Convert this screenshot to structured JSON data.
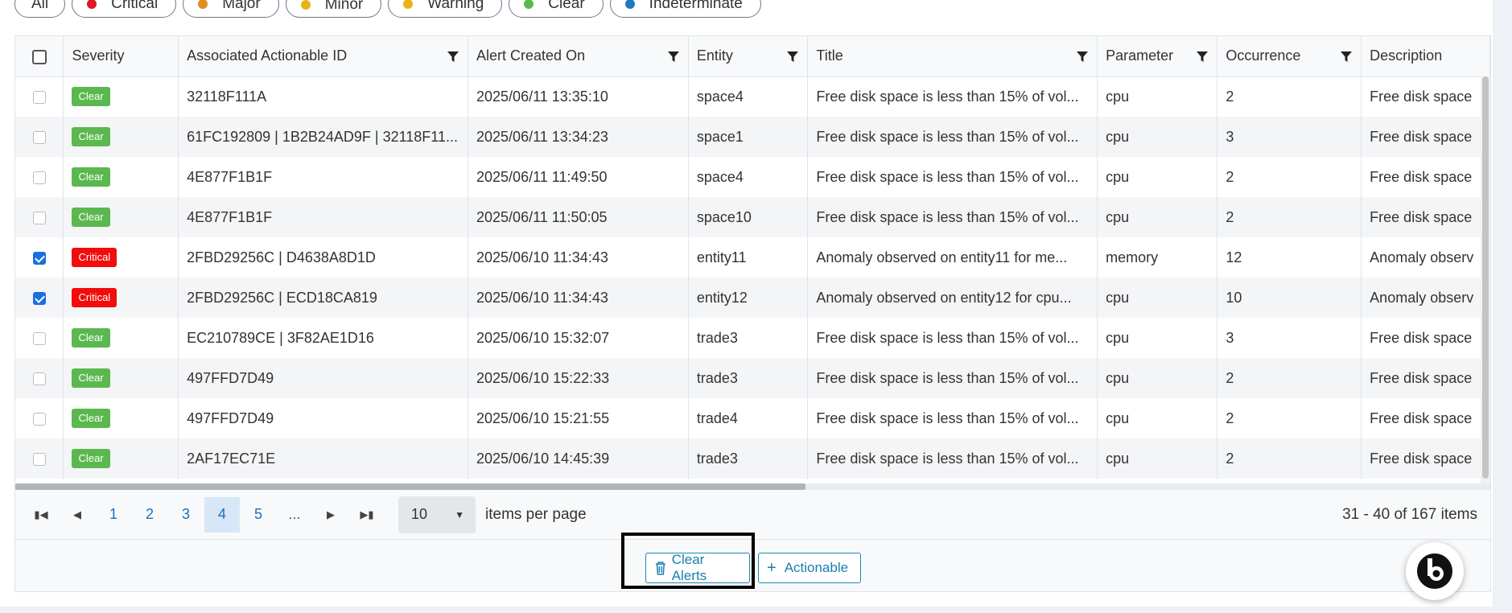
{
  "filters": [
    {
      "label": "All",
      "dot": null,
      "active": false
    },
    {
      "label": "Critical",
      "dot": "#e0181f",
      "active": false
    },
    {
      "label": "Major",
      "dot": "#e08e1c",
      "active": false
    },
    {
      "label": "Minor",
      "dot": "#e8b31a",
      "active": true
    },
    {
      "label": "Warning",
      "dot": "#e8b31a",
      "active": false
    },
    {
      "label": "Clear",
      "dot": "#5bb84f",
      "active": false
    },
    {
      "label": "Indeterminate",
      "dot": "#1a7bc2",
      "active": false
    }
  ],
  "columns": {
    "severity": "Severity",
    "actionable_id": "Associated Actionable ID",
    "created_on": "Alert Created On",
    "entity": "Entity",
    "title": "Title",
    "parameter": "Parameter",
    "occurrence": "Occurrence",
    "description": "Description"
  },
  "rows": [
    {
      "checked": false,
      "severity": "Clear",
      "actionable_id": "32118F111A",
      "created_on": "2025/06/11 13:35:10",
      "entity": "space4",
      "title": "Free disk space is less than 15% of vol...",
      "parameter": "cpu",
      "occurrence": "2",
      "description": "Free disk space"
    },
    {
      "checked": false,
      "severity": "Clear",
      "actionable_id": "61FC192809 | 1B2B24AD9F | 32118F11...",
      "created_on": "2025/06/11 13:34:23",
      "entity": "space1",
      "title": "Free disk space is less than 15% of vol...",
      "parameter": "cpu",
      "occurrence": "3",
      "description": "Free disk space"
    },
    {
      "checked": false,
      "severity": "Clear",
      "actionable_id": "4E877F1B1F",
      "created_on": "2025/06/11 11:49:50",
      "entity": "space4",
      "title": "Free disk space is less than 15% of vol...",
      "parameter": "cpu",
      "occurrence": "2",
      "description": "Free disk space"
    },
    {
      "checked": false,
      "severity": "Clear",
      "actionable_id": "4E877F1B1F",
      "created_on": "2025/06/11 11:50:05",
      "entity": "space10",
      "title": "Free disk space is less than 15% of vol...",
      "parameter": "cpu",
      "occurrence": "2",
      "description": "Free disk space"
    },
    {
      "checked": true,
      "severity": "Critical",
      "actionable_id": "2FBD29256C | D4638A8D1D",
      "created_on": "2025/06/10 11:34:43",
      "entity": "entity11",
      "title": "Anomaly observed on entity11 for me...",
      "parameter": "memory",
      "occurrence": "12",
      "description": "Anomaly observ"
    },
    {
      "checked": true,
      "severity": "Critical",
      "actionable_id": "2FBD29256C | ECD18CA819",
      "created_on": "2025/06/10 11:34:43",
      "entity": "entity12",
      "title": "Anomaly observed on entity12 for cpu...",
      "parameter": "cpu",
      "occurrence": "10",
      "description": "Anomaly observ"
    },
    {
      "checked": false,
      "severity": "Clear",
      "actionable_id": "EC210789CE | 3F82AE1D16",
      "created_on": "2025/06/10 15:32:07",
      "entity": "trade3",
      "title": "Free disk space is less than 15% of vol...",
      "parameter": "cpu",
      "occurrence": "3",
      "description": "Free disk space"
    },
    {
      "checked": false,
      "severity": "Clear",
      "actionable_id": "497FFD7D49",
      "created_on": "2025/06/10 15:22:33",
      "entity": "trade3",
      "title": "Free disk space is less than 15% of vol...",
      "parameter": "cpu",
      "occurrence": "2",
      "description": "Free disk space"
    },
    {
      "checked": false,
      "severity": "Clear",
      "actionable_id": "497FFD7D49",
      "created_on": "2025/06/10 15:21:55",
      "entity": "trade4",
      "title": "Free disk space is less than 15% of vol...",
      "parameter": "cpu",
      "occurrence": "2",
      "description": "Free disk space"
    },
    {
      "checked": false,
      "severity": "Clear",
      "actionable_id": "2AF17EC71E",
      "created_on": "2025/06/10 14:45:39",
      "entity": "trade3",
      "title": "Free disk space is less than 15% of vol...",
      "parameter": "cpu",
      "occurrence": "2",
      "description": "Free disk space"
    }
  ],
  "pager": {
    "pages": [
      "1",
      "2",
      "3",
      "4",
      "5",
      "..."
    ],
    "current": "4",
    "page_size": "10",
    "items_per_page_label": "items per page",
    "info": "31 - 40 of 167 items"
  },
  "actions": {
    "clear_alerts": "Clear Alerts",
    "actionable": "Actionable"
  },
  "icons": {
    "filter": "filter-icon",
    "trash": "trash-icon",
    "plus": "plus-icon",
    "first": "first-page-icon",
    "prev": "prev-page-icon",
    "next": "next-page-icon",
    "last": "last-page-icon",
    "dropdown": "chevron-down-icon",
    "fab": "assistant-logo-icon"
  },
  "colors": {
    "accent": "#1a7fb0",
    "critical": "#f20c0c",
    "clear": "#5bb84f"
  }
}
